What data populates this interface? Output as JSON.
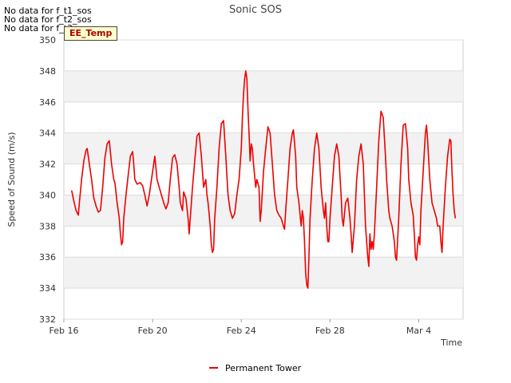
{
  "no_data_notes": [
    "No data for f_t1_sos",
    "No data for f_t2_sos",
    "No data for f_t3_sos"
  ],
  "tag_label": "EE_Temp",
  "chart_data": {
    "type": "line",
    "title": "Sonic SOS",
    "xlabel": "Time",
    "ylabel": "Speed of Sound (m/s)",
    "x_unit": "days",
    "xlim": [
      0,
      18
    ],
    "ylim": [
      332,
      350
    ],
    "y_ticks": [
      332,
      334,
      336,
      338,
      340,
      342,
      344,
      346,
      348,
      350
    ],
    "x_ticks": [
      {
        "pos": 0,
        "label": "Feb 16"
      },
      {
        "pos": 4,
        "label": "Feb 20"
      },
      {
        "pos": 8,
        "label": "Feb 24"
      },
      {
        "pos": 12,
        "label": "Feb 28"
      },
      {
        "pos": 16,
        "label": "Mar 4"
      }
    ],
    "grid": true,
    "legend": "bottom-center",
    "series": [
      {
        "name": "Permanent Tower",
        "color": "#ee0000",
        "points": [
          [
            0.35,
            340.3
          ],
          [
            0.45,
            339.6
          ],
          [
            0.55,
            339.0
          ],
          [
            0.65,
            338.7
          ],
          [
            0.7,
            339.5
          ],
          [
            0.8,
            341.0
          ],
          [
            0.9,
            342.2
          ],
          [
            1.0,
            342.9
          ],
          [
            1.05,
            343.0
          ],
          [
            1.15,
            342.0
          ],
          [
            1.25,
            341.0
          ],
          [
            1.35,
            339.8
          ],
          [
            1.45,
            339.3
          ],
          [
            1.55,
            338.9
          ],
          [
            1.65,
            339.0
          ],
          [
            1.75,
            340.5
          ],
          [
            1.85,
            342.4
          ],
          [
            1.95,
            343.3
          ],
          [
            2.05,
            343.5
          ],
          [
            2.15,
            342.0
          ],
          [
            2.25,
            341.0
          ],
          [
            2.3,
            340.8
          ],
          [
            2.4,
            339.5
          ],
          [
            2.5,
            338.5
          ],
          [
            2.55,
            337.5
          ],
          [
            2.6,
            336.8
          ],
          [
            2.65,
            337.0
          ],
          [
            2.7,
            338.5
          ],
          [
            2.8,
            340.0
          ],
          [
            2.9,
            341.3
          ],
          [
            3.0,
            342.5
          ],
          [
            3.1,
            342.8
          ],
          [
            3.15,
            342.0
          ],
          [
            3.2,
            341.0
          ],
          [
            3.3,
            340.7
          ],
          [
            3.45,
            340.8
          ],
          [
            3.55,
            340.6
          ],
          [
            3.65,
            340.0
          ],
          [
            3.75,
            339.3
          ],
          [
            3.85,
            340.0
          ],
          [
            3.95,
            341.0
          ],
          [
            4.05,
            342.0
          ],
          [
            4.1,
            342.5
          ],
          [
            4.2,
            341.0
          ],
          [
            4.3,
            340.5
          ],
          [
            4.4,
            340.0
          ],
          [
            4.5,
            339.5
          ],
          [
            4.6,
            339.1
          ],
          [
            4.7,
            339.5
          ],
          [
            4.8,
            341.0
          ],
          [
            4.9,
            342.4
          ],
          [
            5.0,
            342.6
          ],
          [
            5.1,
            342.0
          ],
          [
            5.2,
            340.5
          ],
          [
            5.25,
            339.5
          ],
          [
            5.35,
            339.0
          ],
          [
            5.4,
            340.2
          ],
          [
            5.5,
            339.8
          ],
          [
            5.6,
            338.5
          ],
          [
            5.65,
            337.5
          ],
          [
            5.7,
            338.5
          ],
          [
            5.8,
            340.5
          ],
          [
            5.9,
            342.2
          ],
          [
            6.0,
            343.8
          ],
          [
            6.1,
            344.0
          ],
          [
            6.2,
            342.5
          ],
          [
            6.3,
            340.5
          ],
          [
            6.4,
            341.0
          ],
          [
            6.45,
            340.0
          ],
          [
            6.5,
            339.5
          ],
          [
            6.55,
            338.8
          ],
          [
            6.6,
            338.0
          ],
          [
            6.65,
            336.8
          ],
          [
            6.7,
            336.3
          ],
          [
            6.75,
            336.5
          ],
          [
            6.8,
            338.5
          ],
          [
            6.9,
            340.5
          ],
          [
            7.0,
            343.0
          ],
          [
            7.1,
            344.6
          ],
          [
            7.2,
            344.8
          ],
          [
            7.3,
            342.5
          ],
          [
            7.4,
            340.0
          ],
          [
            7.5,
            339.0
          ],
          [
            7.6,
            338.5
          ],
          [
            7.7,
            338.8
          ],
          [
            7.8,
            340.0
          ],
          [
            7.9,
            341.0
          ],
          [
            8.0,
            343.0
          ],
          [
            8.05,
            345.0
          ],
          [
            8.1,
            346.5
          ],
          [
            8.15,
            347.5
          ],
          [
            8.2,
            348.0
          ],
          [
            8.25,
            347.5
          ],
          [
            8.3,
            345.5
          ],
          [
            8.35,
            344.0
          ],
          [
            8.4,
            342.2
          ],
          [
            8.45,
            343.3
          ],
          [
            8.5,
            343.0
          ],
          [
            8.55,
            342.0
          ],
          [
            8.65,
            340.5
          ],
          [
            8.7,
            341.0
          ],
          [
            8.8,
            340.5
          ],
          [
            8.85,
            338.3
          ],
          [
            8.9,
            339.0
          ],
          [
            9.0,
            341.5
          ],
          [
            9.1,
            343.0
          ],
          [
            9.2,
            344.4
          ],
          [
            9.3,
            344.0
          ],
          [
            9.4,
            342.0
          ],
          [
            9.5,
            340.0
          ],
          [
            9.6,
            339.0
          ],
          [
            9.7,
            338.7
          ],
          [
            9.8,
            338.5
          ],
          [
            9.9,
            338.0
          ],
          [
            9.95,
            337.8
          ],
          [
            10.0,
            339.0
          ],
          [
            10.1,
            341.0
          ],
          [
            10.2,
            343.0
          ],
          [
            10.3,
            344.0
          ],
          [
            10.35,
            344.2
          ],
          [
            10.45,
            342.5
          ],
          [
            10.5,
            340.5
          ],
          [
            10.6,
            339.5
          ],
          [
            10.7,
            338.0
          ],
          [
            10.75,
            339.0
          ],
          [
            10.8,
            338.5
          ],
          [
            10.85,
            337.0
          ],
          [
            10.9,
            335.0
          ],
          [
            10.95,
            334.2
          ],
          [
            11.0,
            334.0
          ],
          [
            11.05,
            336.0
          ],
          [
            11.1,
            338.5
          ],
          [
            11.2,
            341.0
          ],
          [
            11.3,
            343.0
          ],
          [
            11.4,
            344.0
          ],
          [
            11.5,
            343.0
          ],
          [
            11.6,
            340.5
          ],
          [
            11.7,
            339.0
          ],
          [
            11.75,
            338.5
          ],
          [
            11.8,
            339.5
          ],
          [
            11.85,
            338.0
          ],
          [
            11.9,
            337.0
          ],
          [
            11.95,
            337.0
          ],
          [
            12.0,
            338.5
          ],
          [
            12.1,
            340.5
          ],
          [
            12.2,
            342.5
          ],
          [
            12.3,
            343.3
          ],
          [
            12.4,
            342.5
          ],
          [
            12.5,
            340.0
          ],
          [
            12.55,
            338.5
          ],
          [
            12.6,
            338.0
          ],
          [
            12.7,
            339.5
          ],
          [
            12.8,
            339.8
          ],
          [
            12.9,
            338.5
          ],
          [
            12.95,
            337.5
          ],
          [
            13.0,
            336.3
          ],
          [
            13.1,
            338.0
          ],
          [
            13.2,
            341.0
          ],
          [
            13.3,
            342.5
          ],
          [
            13.4,
            343.3
          ],
          [
            13.5,
            342.0
          ],
          [
            13.55,
            340.0
          ],
          [
            13.6,
            338.0
          ],
          [
            13.7,
            336.0
          ],
          [
            13.75,
            335.4
          ],
          [
            13.8,
            337.5
          ],
          [
            13.85,
            336.5
          ],
          [
            13.9,
            337.0
          ],
          [
            13.95,
            336.5
          ],
          [
            14.0,
            337.5
          ],
          [
            14.1,
            340.5
          ],
          [
            14.2,
            343.5
          ],
          [
            14.3,
            345.4
          ],
          [
            14.4,
            345.0
          ],
          [
            14.5,
            342.5
          ],
          [
            14.55,
            341.0
          ],
          [
            14.65,
            339.0
          ],
          [
            14.7,
            338.5
          ],
          [
            14.8,
            338.0
          ],
          [
            14.9,
            337.0
          ],
          [
            14.95,
            336.0
          ],
          [
            15.0,
            335.8
          ],
          [
            15.1,
            338.5
          ],
          [
            15.2,
            342.0
          ],
          [
            15.3,
            344.5
          ],
          [
            15.4,
            344.6
          ],
          [
            15.5,
            343.0
          ],
          [
            15.55,
            341.0
          ],
          [
            15.65,
            339.5
          ],
          [
            15.75,
            338.7
          ],
          [
            15.8,
            337.5
          ],
          [
            15.85,
            336.0
          ],
          [
            15.9,
            335.8
          ],
          [
            15.95,
            336.8
          ],
          [
            16.0,
            337.3
          ],
          [
            16.05,
            336.8
          ],
          [
            16.1,
            339.0
          ],
          [
            16.2,
            341.5
          ],
          [
            16.3,
            344.0
          ],
          [
            16.35,
            344.5
          ],
          [
            16.4,
            343.5
          ],
          [
            16.5,
            341.0
          ],
          [
            16.6,
            339.5
          ],
          [
            16.7,
            339.0
          ],
          [
            16.8,
            338.5
          ],
          [
            16.85,
            338.0
          ],
          [
            16.95,
            338.0
          ],
          [
            17.0,
            337.0
          ],
          [
            17.05,
            336.3
          ],
          [
            17.1,
            338.0
          ],
          [
            17.2,
            340.5
          ],
          [
            17.3,
            342.5
          ],
          [
            17.4,
            343.6
          ],
          [
            17.45,
            343.5
          ],
          [
            17.5,
            341.5
          ],
          [
            17.55,
            340.0
          ],
          [
            17.6,
            339.0
          ],
          [
            17.65,
            338.5
          ]
        ]
      }
    ]
  }
}
